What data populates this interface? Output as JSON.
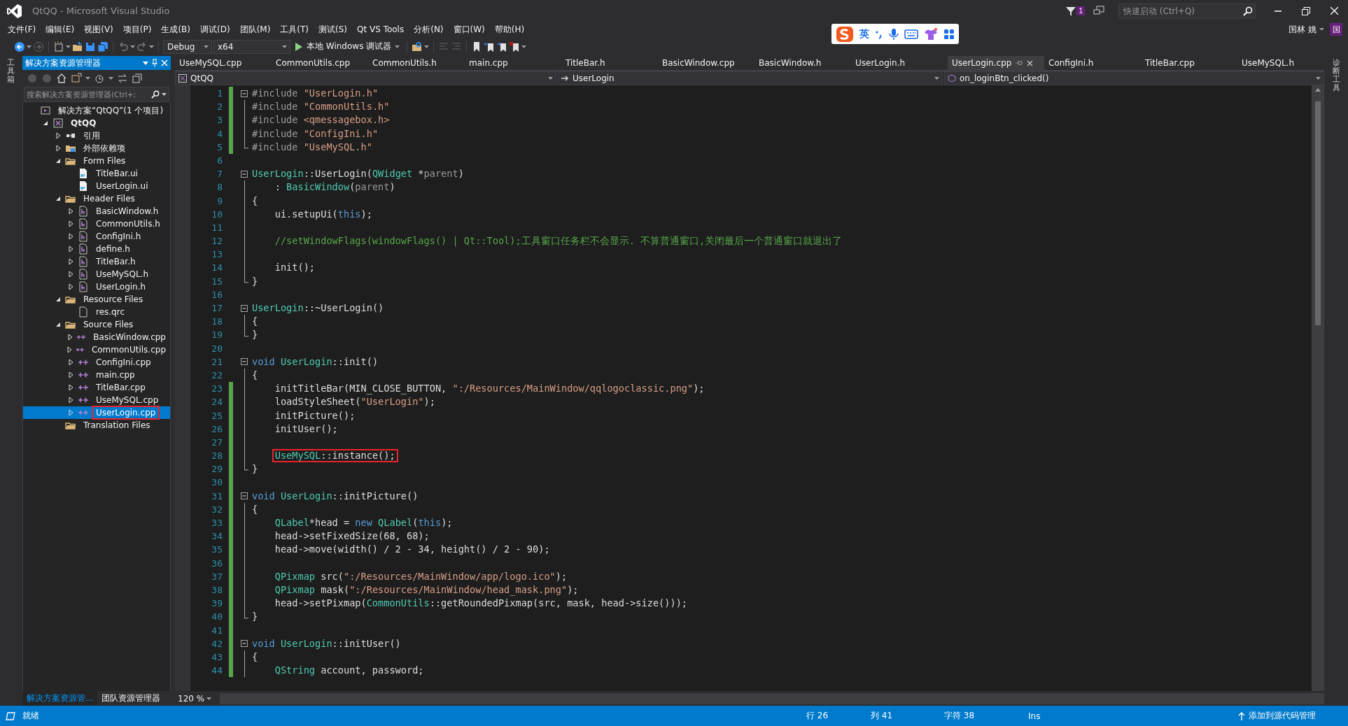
{
  "window": {
    "title": "QtQQ - Microsoft Visual Studio"
  },
  "title_bar": {
    "notification_count": "1",
    "quick_launch": {
      "placeholder": "快速启动 (Ctrl+Q)"
    }
  },
  "menu": [
    "文件(F)",
    "编辑(E)",
    "视图(V)",
    "项目(P)",
    "生成(B)",
    "调试(D)",
    "团队(M)",
    "工具(T)",
    "测试(S)",
    "Qt VS Tools",
    "分析(N)",
    "窗口(W)",
    "帮助(H)"
  ],
  "account": {
    "name": "国林 姚",
    "avatar": "国"
  },
  "ime_bar": {
    "mode": "英"
  },
  "toolbar": {
    "configuration": "Debug",
    "platform": "x64",
    "run_label": "本地 Windows 调试器"
  },
  "toolbox_strip": {
    "label": "工具箱"
  },
  "diagnostics_strip": {
    "label": "诊断工具"
  },
  "solution_explorer": {
    "title": "解决方案资源管理器",
    "search": {
      "placeholder": "搜索解决方案资源管理器(Ctrl+;"
    },
    "tree": [
      {
        "label": "解决方案“QtQQ”(1 个项目)",
        "kind": "solution",
        "selected": false,
        "marked": false,
        "children": [
          {
            "label": "QtQQ",
            "kind": "project",
            "expanded": true,
            "selected": false,
            "marked": false,
            "children": [
              {
                "label": "引用",
                "kind": "references",
                "expanded": false,
                "selected": false,
                "marked": false
              },
              {
                "label": "外部依赖项",
                "kind": "external",
                "expanded": false,
                "selected": false,
                "marked": false
              },
              {
                "label": "Form Files",
                "kind": "folder",
                "expanded": true,
                "selected": false,
                "marked": false,
                "children": [
                  {
                    "label": "TitleBar.ui",
                    "kind": "ui",
                    "selected": false,
                    "marked": false
                  },
                  {
                    "label": "UserLogin.ui",
                    "kind": "ui",
                    "selected": false,
                    "marked": false
                  }
                ]
              },
              {
                "label": "Header Files",
                "kind": "folder",
                "expanded": true,
                "selected": false,
                "marked": false,
                "children": [
                  {
                    "label": "BasicWindow.h",
                    "kind": "header",
                    "expanded": false,
                    "selected": false,
                    "marked": false
                  },
                  {
                    "label": "CommonUtils.h",
                    "kind": "header",
                    "expanded": false,
                    "selected": false,
                    "marked": false
                  },
                  {
                    "label": "ConfigIni.h",
                    "kind": "header",
                    "expanded": false,
                    "selected": false,
                    "marked": false
                  },
                  {
                    "label": "define.h",
                    "kind": "header",
                    "expanded": false,
                    "selected": false,
                    "marked": false
                  },
                  {
                    "label": "TitleBar.h",
                    "kind": "header",
                    "expanded": false,
                    "selected": false,
                    "marked": false
                  },
                  {
                    "label": "UseMySQL.h",
                    "kind": "header",
                    "expanded": false,
                    "selected": false,
                    "marked": false
                  },
                  {
                    "label": "UserLogin.h",
                    "kind": "header",
                    "expanded": false,
                    "selected": false,
                    "marked": false
                  }
                ]
              },
              {
                "label": "Resource Files",
                "kind": "folder",
                "expanded": true,
                "selected": false,
                "marked": false,
                "children": [
                  {
                    "label": "res.qrc",
                    "kind": "resource",
                    "selected": false,
                    "marked": false
                  }
                ]
              },
              {
                "label": "Source Files",
                "kind": "folder",
                "expanded": true,
                "selected": false,
                "marked": false,
                "children": [
                  {
                    "label": "BasicWindow.cpp",
                    "kind": "source",
                    "expanded": false,
                    "selected": false,
                    "marked": false
                  },
                  {
                    "label": "CommonUtils.cpp",
                    "kind": "source",
                    "expanded": false,
                    "selected": false,
                    "marked": false
                  },
                  {
                    "label": "ConfigIni.cpp",
                    "kind": "source",
                    "expanded": false,
                    "selected": false,
                    "marked": false
                  },
                  {
                    "label": "main.cpp",
                    "kind": "source",
                    "expanded": false,
                    "selected": false,
                    "marked": false
                  },
                  {
                    "label": "TitleBar.cpp",
                    "kind": "source",
                    "expanded": false,
                    "selected": false,
                    "marked": false
                  },
                  {
                    "label": "UseMySQL.cpp",
                    "kind": "source",
                    "expanded": false,
                    "selected": false,
                    "marked": false
                  },
                  {
                    "label": "UserLogin.cpp",
                    "kind": "source",
                    "expanded": false,
                    "selected": true,
                    "marked": true
                  }
                ]
              },
              {
                "label": "Translation Files",
                "kind": "folder",
                "selected": false,
                "marked": false
              }
            ]
          }
        ]
      }
    ],
    "bottom_tabs": [
      {
        "label": "解决方案资源管...",
        "selected": true
      },
      {
        "label": "团队资源管理器",
        "selected": false
      }
    ]
  },
  "editor": {
    "tabs": [
      {
        "label": "UseMySQL.cpp",
        "selected": false
      },
      {
        "label": "CommonUtils.cpp",
        "selected": false
      },
      {
        "label": "CommonUtils.h",
        "selected": false
      },
      {
        "label": "main.cpp",
        "selected": false
      },
      {
        "label": "TitleBar.h",
        "selected": false
      },
      {
        "label": "BasicWindow.cpp",
        "selected": false
      },
      {
        "label": "BasicWindow.h",
        "selected": false
      },
      {
        "label": "UserLogin.h",
        "selected": false
      },
      {
        "label": "UserLogin.cpp",
        "selected": true
      },
      {
        "label": "ConfigIni.h",
        "selected": false
      },
      {
        "label": "TitleBar.cpp",
        "selected": false
      },
      {
        "label": "UseMySQL.h",
        "selected": false
      }
    ],
    "nav": {
      "project": "QtQQ",
      "class": "UserLogin",
      "member": "on_loginBtn_clicked()"
    },
    "lines": [
      {
        "n": "1",
        "changed": true,
        "fold": {
          "kind": "start"
        },
        "marked": false,
        "indented": false,
        "tokens": [
          {
            "kind": "pp",
            "text": "#include "
          },
          {
            "kind": "str",
            "text": "\"UserLogin.h\""
          }
        ]
      },
      {
        "n": "2",
        "changed": true,
        "fold": {
          "kind": "in"
        },
        "marked": false,
        "indented": false,
        "tokens": [
          {
            "kind": "pp",
            "text": "#include "
          },
          {
            "kind": "str",
            "text": "\"CommonUtils.h\""
          }
        ]
      },
      {
        "n": "3",
        "changed": true,
        "fold": {
          "kind": "in"
        },
        "marked": false,
        "indented": false,
        "tokens": [
          {
            "kind": "pp",
            "text": "#include "
          },
          {
            "kind": "str",
            "text": "<qmessagebox.h>"
          }
        ]
      },
      {
        "n": "4",
        "changed": true,
        "fold": {
          "kind": "in"
        },
        "marked": false,
        "indented": false,
        "tokens": [
          {
            "kind": "pp",
            "text": "#include "
          },
          {
            "kind": "str",
            "text": "\"ConfigIni.h\""
          }
        ]
      },
      {
        "n": "5",
        "changed": true,
        "fold": {
          "kind": "end"
        },
        "marked": false,
        "indented": false,
        "tokens": [
          {
            "kind": "pp",
            "text": "#include "
          },
          {
            "kind": "str",
            "text": "\"UseMySQL.h\""
          }
        ]
      },
      {
        "n": "6",
        "changed": false,
        "marked": false
      },
      {
        "n": "7",
        "changed": false,
        "fold": {
          "kind": "start"
        },
        "marked": false,
        "indented": false,
        "tokens": [
          {
            "kind": "type",
            "text": "UserLogin"
          },
          {
            "kind": "plain",
            "text": "::UserLogin("
          },
          {
            "kind": "type",
            "text": "QWidget"
          },
          {
            "kind": "plain",
            "text": " *"
          },
          {
            "kind": "param",
            "text": "parent"
          },
          {
            "kind": "plain",
            "text": ")"
          }
        ]
      },
      {
        "n": "8",
        "changed": false,
        "fold": {
          "kind": "in"
        },
        "marked": false,
        "indented": true,
        "tokens": [
          {
            "kind": "plain",
            "text": ": "
          },
          {
            "kind": "type",
            "text": "BasicWindow"
          },
          {
            "kind": "plain",
            "text": "("
          },
          {
            "kind": "param",
            "text": "parent"
          },
          {
            "kind": "plain",
            "text": ")"
          }
        ]
      },
      {
        "n": "9",
        "changed": false,
        "fold": {
          "kind": "in"
        },
        "marked": false,
        "indented": false,
        "tokens": [
          {
            "kind": "plain",
            "text": "{"
          }
        ]
      },
      {
        "n": "10",
        "changed": false,
        "fold": {
          "kind": "in"
        },
        "marked": false,
        "indented": true,
        "tokens": [
          {
            "kind": "plain",
            "text": "ui.setupUi("
          },
          {
            "kind": "kw",
            "text": "this"
          },
          {
            "kind": "plain",
            "text": ");"
          }
        ]
      },
      {
        "n": "11",
        "changed": false,
        "fold": {
          "kind": "in"
        },
        "marked": false
      },
      {
        "n": "12",
        "changed": false,
        "fold": {
          "kind": "in"
        },
        "marked": false,
        "indented": true,
        "tokens": [
          {
            "kind": "comment",
            "text": "//setWindowFlags(windowFlags() | Qt::Tool);工具窗口任务栏不会显示. 不算普通窗口,关闭最后一个普通窗口就退出了"
          }
        ]
      },
      {
        "n": "13",
        "changed": false,
        "fold": {
          "kind": "in"
        },
        "marked": false
      },
      {
        "n": "14",
        "changed": false,
        "fold": {
          "kind": "in"
        },
        "marked": false,
        "indented": true,
        "tokens": [
          {
            "kind": "plain",
            "text": "init();"
          }
        ]
      },
      {
        "n": "15",
        "changed": false,
        "fold": {
          "kind": "end"
        },
        "marked": false,
        "indented": false,
        "tokens": [
          {
            "kind": "plain",
            "text": "}"
          }
        ]
      },
      {
        "n": "16",
        "changed": false,
        "marked": false
      },
      {
        "n": "17",
        "changed": false,
        "fold": {
          "kind": "start"
        },
        "marked": false,
        "indented": false,
        "tokens": [
          {
            "kind": "type",
            "text": "UserLogin"
          },
          {
            "kind": "plain",
            "text": "::~UserLogin()"
          }
        ]
      },
      {
        "n": "18",
        "changed": false,
        "fold": {
          "kind": "in"
        },
        "marked": false,
        "indented": false,
        "tokens": [
          {
            "kind": "plain",
            "text": "{"
          }
        ]
      },
      {
        "n": "19",
        "changed": false,
        "fold": {
          "kind": "end"
        },
        "marked": false,
        "indented": false,
        "tokens": [
          {
            "kind": "plain",
            "text": "}"
          }
        ]
      },
      {
        "n": "20",
        "changed": false,
        "marked": false
      },
      {
        "n": "21",
        "changed": false,
        "fold": {
          "kind": "start"
        },
        "marked": false,
        "indented": false,
        "tokens": [
          {
            "kind": "kw",
            "text": "void "
          },
          {
            "kind": "type",
            "text": "UserLogin"
          },
          {
            "kind": "plain",
            "text": "::init()"
          }
        ]
      },
      {
        "n": "22",
        "changed": false,
        "fold": {
          "kind": "in"
        },
        "marked": false,
        "indented": false,
        "tokens": [
          {
            "kind": "plain",
            "text": "{"
          }
        ]
      },
      {
        "n": "23",
        "changed": true,
        "fold": {
          "kind": "in"
        },
        "marked": false,
        "indented": true,
        "tokens": [
          {
            "kind": "plain",
            "text": "initTitleBar(MIN_CLOSE_BUTTON, "
          },
          {
            "kind": "str",
            "text": "\":/Resources/MainWindow/qqlogoclassic.png\""
          },
          {
            "kind": "plain",
            "text": ");"
          }
        ]
      },
      {
        "n": "24",
        "changed": true,
        "fold": {
          "kind": "in"
        },
        "marked": false,
        "indented": true,
        "tokens": [
          {
            "kind": "plain",
            "text": "loadStyleSheet("
          },
          {
            "kind": "str",
            "text": "\"UserLogin\""
          },
          {
            "kind": "plain",
            "text": ");"
          }
        ]
      },
      {
        "n": "25",
        "changed": true,
        "fold": {
          "kind": "in"
        },
        "marked": false,
        "indented": true,
        "tokens": [
          {
            "kind": "plain",
            "text": "initPicture();"
          }
        ]
      },
      {
        "n": "26",
        "changed": true,
        "fold": {
          "kind": "in"
        },
        "marked": false,
        "indented": true,
        "tokens": [
          {
            "kind": "plain",
            "text": "initUser();"
          }
        ]
      },
      {
        "n": "27",
        "changed": true,
        "fold": {
          "kind": "in"
        },
        "marked": false
      },
      {
        "n": "28",
        "changed": true,
        "fold": {
          "kind": "in"
        },
        "marked": true,
        "indented": true,
        "tokens": [
          {
            "kind": "type",
            "text": "UseMySQL"
          },
          {
            "kind": "plain",
            "text": "::instance();"
          }
        ]
      },
      {
        "n": "29",
        "changed": true,
        "fold": {
          "kind": "end"
        },
        "marked": false,
        "indented": false,
        "tokens": [
          {
            "kind": "plain",
            "text": "}"
          }
        ]
      },
      {
        "n": "30",
        "changed": true,
        "marked": false
      },
      {
        "n": "31",
        "changed": true,
        "fold": {
          "kind": "start"
        },
        "marked": false,
        "indented": false,
        "tokens": [
          {
            "kind": "kw",
            "text": "void "
          },
          {
            "kind": "type",
            "text": "UserLogin"
          },
          {
            "kind": "plain",
            "text": "::initPicture()"
          }
        ]
      },
      {
        "n": "32",
        "changed": true,
        "fold": {
          "kind": "in"
        },
        "marked": false,
        "indented": false,
        "tokens": [
          {
            "kind": "plain",
            "text": "{"
          }
        ]
      },
      {
        "n": "33",
        "changed": true,
        "fold": {
          "kind": "in"
        },
        "marked": false,
        "indented": true,
        "tokens": [
          {
            "kind": "type",
            "text": "QLabel"
          },
          {
            "kind": "plain",
            "text": "*head = "
          },
          {
            "kind": "kw",
            "text": "new "
          },
          {
            "kind": "type",
            "text": "QLabel"
          },
          {
            "kind": "plain",
            "text": "("
          },
          {
            "kind": "kw",
            "text": "this"
          },
          {
            "kind": "plain",
            "text": ");"
          }
        ]
      },
      {
        "n": "34",
        "changed": true,
        "fold": {
          "kind": "in"
        },
        "marked": false,
        "indented": true,
        "tokens": [
          {
            "kind": "plain",
            "text": "head->setFixedSize(68, 68);"
          }
        ]
      },
      {
        "n": "35",
        "changed": true,
        "fold": {
          "kind": "in"
        },
        "marked": false,
        "indented": true,
        "tokens": [
          {
            "kind": "plain",
            "text": "head->move(width() / 2 - 34, height() / 2 - 90);"
          }
        ]
      },
      {
        "n": "36",
        "changed": true,
        "fold": {
          "kind": "in"
        },
        "marked": false
      },
      {
        "n": "37",
        "changed": true,
        "fold": {
          "kind": "in"
        },
        "marked": false,
        "indented": true,
        "tokens": [
          {
            "kind": "type",
            "text": "QPixmap"
          },
          {
            "kind": "plain",
            "text": " src("
          },
          {
            "kind": "str",
            "text": "\":/Resources/MainWindow/app/logo.ico\""
          },
          {
            "kind": "plain",
            "text": ");"
          }
        ]
      },
      {
        "n": "38",
        "changed": true,
        "fold": {
          "kind": "in"
        },
        "marked": false,
        "indented": true,
        "tokens": [
          {
            "kind": "type",
            "text": "QPixmap"
          },
          {
            "kind": "plain",
            "text": " mask("
          },
          {
            "kind": "str",
            "text": "\":/Resources/MainWindow/head_mask.png\""
          },
          {
            "kind": "plain",
            "text": ");"
          }
        ]
      },
      {
        "n": "39",
        "changed": true,
        "fold": {
          "kind": "in"
        },
        "marked": false,
        "indented": true,
        "tokens": [
          {
            "kind": "plain",
            "text": "head->setPixmap("
          },
          {
            "kind": "type",
            "text": "CommonUtils"
          },
          {
            "kind": "plain",
            "text": "::getRoundedPixmap(src, mask, head->size()));"
          }
        ]
      },
      {
        "n": "40",
        "changed": true,
        "fold": {
          "kind": "end"
        },
        "marked": false,
        "indented": false,
        "tokens": [
          {
            "kind": "plain",
            "text": "}"
          }
        ]
      },
      {
        "n": "41",
        "changed": true,
        "marked": false
      },
      {
        "n": "42",
        "changed": true,
        "fold": {
          "kind": "start"
        },
        "marked": false,
        "indented": false,
        "tokens": [
          {
            "kind": "kw",
            "text": "void "
          },
          {
            "kind": "type",
            "text": "UserLogin"
          },
          {
            "kind": "plain",
            "text": "::initUser()"
          }
        ]
      },
      {
        "n": "43",
        "changed": true,
        "fold": {
          "kind": "in"
        },
        "marked": false,
        "indented": false,
        "tokens": [
          {
            "kind": "plain",
            "text": "{"
          }
        ]
      },
      {
        "n": "44",
        "changed": true,
        "fold": {
          "kind": "in"
        },
        "marked": false,
        "indented": true,
        "tokens": [
          {
            "kind": "type",
            "text": "QString"
          },
          {
            "kind": "plain",
            "text": " account, password;"
          }
        ]
      }
    ],
    "zoom": "120 %"
  },
  "status_bar": {
    "status": "就绪",
    "line": "行 26",
    "column": "列 41",
    "char": "字符 38",
    "mode": "Ins",
    "source_control": "添加到源代码管理"
  }
}
